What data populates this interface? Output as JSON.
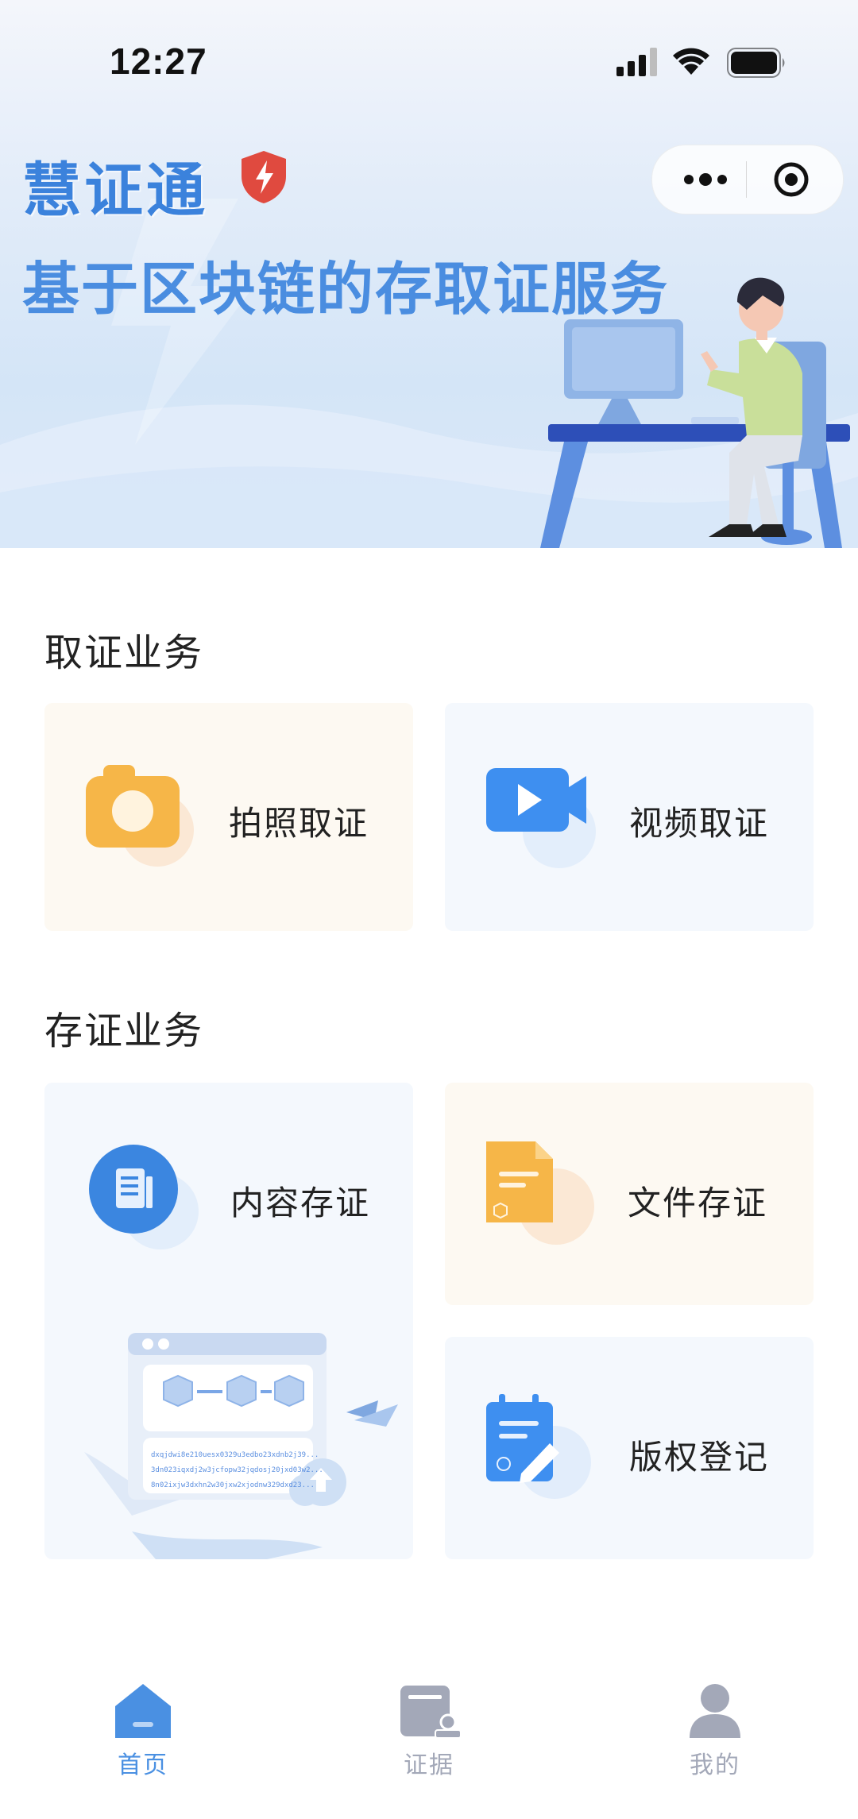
{
  "status_bar": {
    "time": "12:27"
  },
  "hero": {
    "title": "慧证通",
    "subtitle": "基于区块链的存取证服务"
  },
  "sections": {
    "collect": {
      "title": "取证业务",
      "cards": [
        {
          "label": "拍照取证",
          "icon": "camera-icon"
        },
        {
          "label": "视频取证",
          "icon": "video-icon"
        }
      ]
    },
    "store": {
      "title": "存证业务",
      "cards": [
        {
          "label": "内容存证",
          "icon": "document-icon"
        },
        {
          "label": "文件存证",
          "icon": "file-icon"
        },
        {
          "label": "版权登记",
          "icon": "clipboard-edit-icon"
        }
      ],
      "illustration_text": [
        "dxqjdwi8e210uesx0329u3edbo23xdnb2j39...",
        "3dn023iqxdj2w3jcfopw32jqdosj20jxd03w2...",
        "8n02ixjw3dxhn2w30jxw2xjodnw329dxd23..."
      ]
    }
  },
  "tabbar": {
    "items": [
      {
        "label": "首页",
        "icon": "home-icon",
        "active": true
      },
      {
        "label": "证据",
        "icon": "evidence-icon",
        "active": false
      },
      {
        "label": "我的",
        "icon": "user-icon",
        "active": false
      }
    ],
    "active_color": "#4a90e2",
    "inactive_color": "#a3a8b8"
  }
}
